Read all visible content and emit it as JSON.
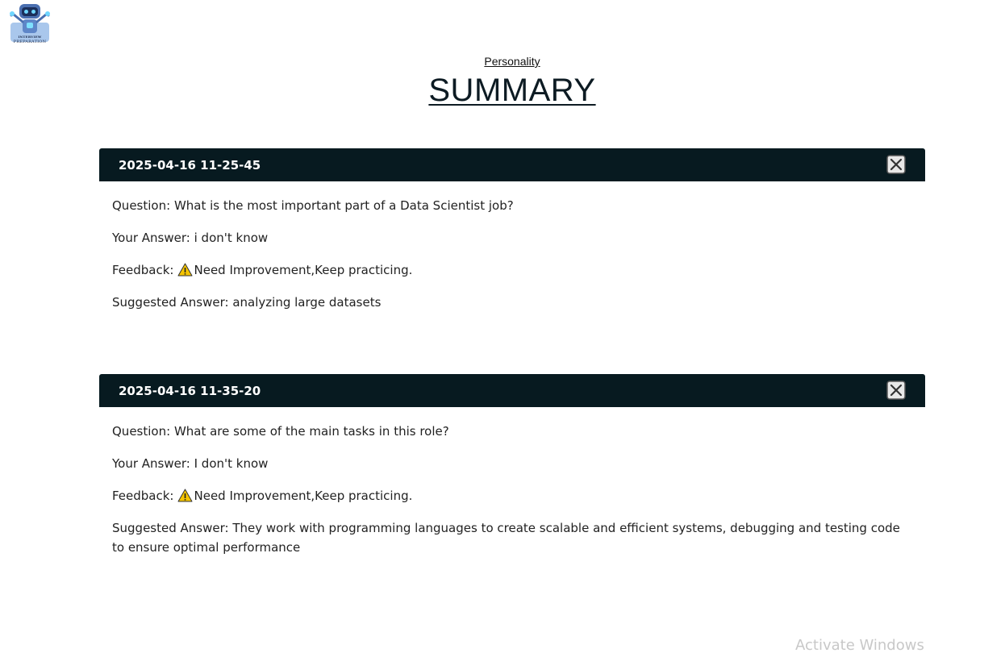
{
  "logo": {
    "icon": "robot-icon",
    "line1": "INTERVIEW",
    "line2": "PREPARATION"
  },
  "header": {
    "category_link": "Personality",
    "title": "SUMMARY"
  },
  "entries": [
    {
      "timestamp": "2025-04-16 11-25-45",
      "question_label": "Question:",
      "question": "What is the most important part of a Data Scientist job?",
      "answer_label": "Your Answer:",
      "answer": "i don't know",
      "feedback_label": "Feedback:",
      "feedback_icon": "warning-icon",
      "feedback": "Need Improvement,Keep practicing.",
      "suggested_label": "Suggested Answer:",
      "suggested": "analyzing large datasets"
    },
    {
      "timestamp": "2025-04-16 11-35-20",
      "question_label": "Question:",
      "question": "What are some of the main tasks in this role?",
      "answer_label": "Your Answer:",
      "answer": "I don't know",
      "feedback_label": "Feedback:",
      "feedback_icon": "warning-icon",
      "feedback": "Need Improvement,Keep practicing.",
      "suggested_label": "Suggested Answer:",
      "suggested": "They work with programming languages to create scalable and efficient systems, debugging and testing code to ensure optimal performance"
    }
  ],
  "watermark": "Activate Windows",
  "colors": {
    "card_header_bg": "#071a20",
    "warning_yellow": "#f5c400"
  }
}
